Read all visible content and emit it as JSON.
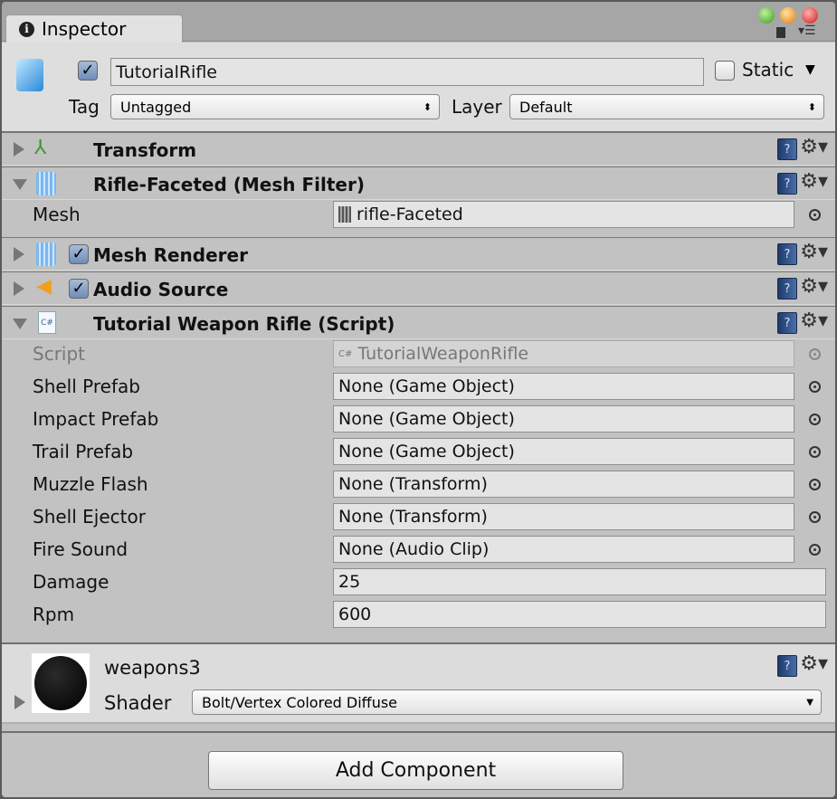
{
  "tab": {
    "title": "Inspector",
    "icon": "info-icon"
  },
  "object": {
    "name": "TutorialRifle",
    "active": true,
    "static_label": "Static",
    "static": false,
    "tag_label": "Tag",
    "tag": "Untagged",
    "layer_label": "Layer",
    "layer": "Default"
  },
  "components": [
    {
      "title": "Transform",
      "expanded": false,
      "icon": "transform-axes-icon"
    },
    {
      "title": "Rifle-Faceted (Mesh Filter)",
      "expanded": true,
      "icon": "mesh-filter-icon"
    },
    {
      "title": "Mesh Renderer",
      "expanded": false,
      "enabled": true,
      "icon": "mesh-renderer-icon"
    },
    {
      "title": "Audio Source",
      "expanded": false,
      "enabled": true,
      "icon": "speaker-icon"
    },
    {
      "title": "Tutorial Weapon Rifle (Script)",
      "expanded": true,
      "icon": "csharp-script-icon"
    }
  ],
  "mesh": {
    "label": "Mesh",
    "value": "rifle-Faceted"
  },
  "script": {
    "label": "Script",
    "value": "TutorialWeaponRifle"
  },
  "fields": [
    {
      "label": "Shell Prefab",
      "value": "None (Game Object)"
    },
    {
      "label": "Impact Prefab",
      "value": "None (Game Object)"
    },
    {
      "label": "Trail Prefab",
      "value": "None (Game Object)"
    },
    {
      "label": "Muzzle Flash",
      "value": "None (Transform)"
    },
    {
      "label": "Shell Ejector",
      "value": "None (Transform)"
    },
    {
      "label": "Fire Sound",
      "value": "None (Audio Clip)"
    },
    {
      "label": "Damage",
      "value": "25"
    },
    {
      "label": "Rpm",
      "value": "600"
    }
  ],
  "material": {
    "name": "weapons3",
    "shader_label": "Shader",
    "shader": "Bolt/Vertex Colored Diffuse"
  },
  "add_component": "Add Component"
}
